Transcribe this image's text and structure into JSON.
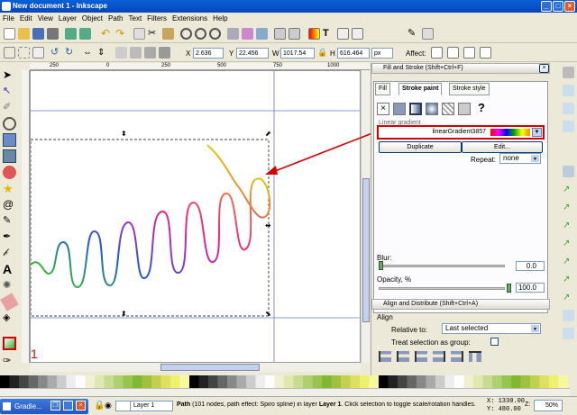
{
  "window": {
    "title": "New document 1 - Inkscape"
  },
  "menu": [
    "File",
    "Edit",
    "View",
    "Layer",
    "Object",
    "Path",
    "Text",
    "Filters",
    "Extensions",
    "Help"
  ],
  "controls": {
    "x_label": "X",
    "x_value": "2.636",
    "y_label": "Y",
    "y_value": "22.456",
    "w_label": "W",
    "w_value": "1017.54",
    "h_label": "H",
    "h_value": "616.464",
    "unit": "px",
    "affect_label": "Affect:"
  },
  "ruler": {
    "ticks": [
      "250",
      "0",
      "250",
      "500",
      "750",
      "1000"
    ]
  },
  "panel": {
    "fill_stroke_title": "Fill and Stroke (Shift+Ctrl+F)",
    "tabs": [
      "Fill",
      "Stroke paint",
      "Stroke style"
    ],
    "question_mark": "?",
    "linear_gradient_label": "Linear gradient",
    "gradient_name": "linearGradient3857",
    "duplicate": "Duplicate",
    "edit": "Edit...",
    "repeat_label": "Repeat:",
    "repeat_value": "none",
    "blur_label": "Blur:",
    "blur_value": "0.0",
    "opacity_label": "Opacity, %",
    "opacity_value": "100.0",
    "align_title": "Align and Distribute (Shift+Ctrl+A)",
    "align_label": "Align",
    "relative_label": "Relative to:",
    "relative_value": "Last selected",
    "treat_group_label": "Treat selection as group:"
  },
  "annotations": {
    "one": "1",
    "two": "2"
  },
  "status": {
    "layer": "Layer 1",
    "message_path": "Path",
    "message": " (101 nodes, path effect: Spiro spline) in layer ",
    "message_layer": "Layer 1",
    "message_end": ". Click selection to toggle scale/rotation handles.",
    "x_coord": "X: 1330.00",
    "y_coord": "Y:  480.00",
    "z_label": "Z:",
    "zoom": "50%"
  },
  "taskbar": {
    "label": "Gradie..."
  },
  "colors": {
    "accent": "#0a5fd8",
    "annotation": "#d30000"
  }
}
